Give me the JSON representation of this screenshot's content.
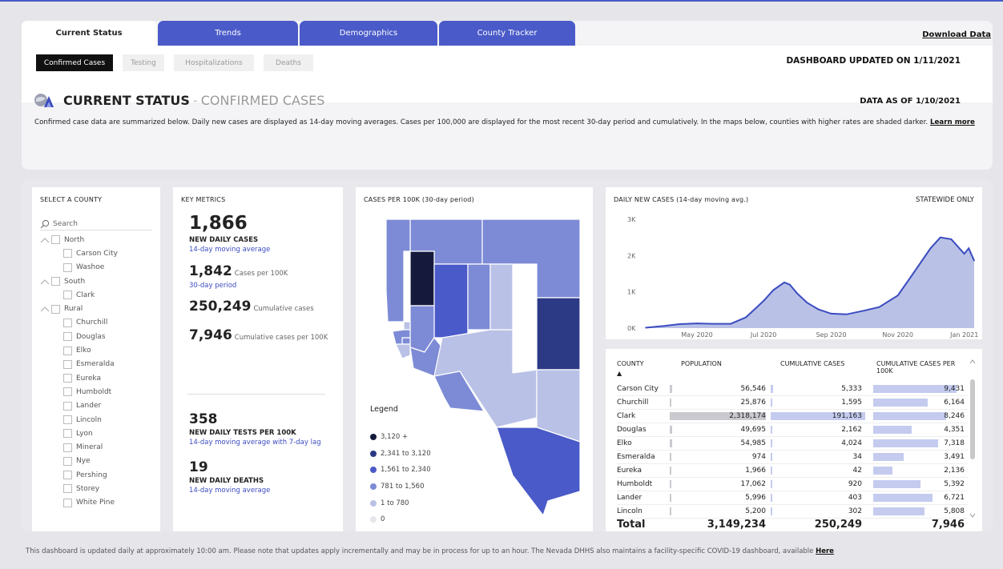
{
  "tabs": [
    {
      "label": "Current Status",
      "active": true
    },
    {
      "label": "Trends",
      "active": false
    },
    {
      "label": "Demographics",
      "active": false
    },
    {
      "label": "County Tracker",
      "active": false
    }
  ],
  "download_label": "Download Data",
  "subtabs": [
    {
      "label": "Confirmed Cases",
      "active": true
    },
    {
      "label": "Testing",
      "active": false
    },
    {
      "label": "Hospitalizations",
      "active": false
    },
    {
      "label": "Deaths",
      "active": false
    }
  ],
  "updated_text": "DASHBOARD UPDATED ON 1/11/2021",
  "title": {
    "main": "CURRENT STATUS",
    "separator": "-",
    "sub": "CONFIRMED CASES"
  },
  "data_as_of": "DATA AS OF 1/10/2021",
  "description": "Confirmed case data are summarized below. Daily new cases are displayed as 14-day moving averages. Cases per 100,000 are displayed for the most recent 30-day period and cumulatively. In the maps below, counties with higher rates are shaded darker.",
  "learn_more": "Learn more",
  "county_panel": {
    "title": "SELECT A COUNTY",
    "search_placeholder": "Search",
    "groups": [
      {
        "label": "North",
        "counties": [
          "Carson City",
          "Washoe"
        ]
      },
      {
        "label": "South",
        "counties": [
          "Clark"
        ]
      },
      {
        "label": "Rural",
        "counties": [
          "Churchill",
          "Douglas",
          "Elko",
          "Esmeralda",
          "Eureka",
          "Humboldt",
          "Lander",
          "Lincoln",
          "Lyon",
          "Mineral",
          "Nye",
          "Pershing",
          "Storey",
          "White Pine"
        ]
      }
    ]
  },
  "metrics": {
    "title": "KEY METRICS",
    "new_daily_cases": "1,866",
    "new_daily_cases_label": "NEW DAILY CASES",
    "new_daily_cases_sub": "14-day moving average",
    "cases_per_100k": "1,842",
    "cases_per_100k_label": "Cases per 100K",
    "cases_per_100k_sub": "30-day period",
    "cumulative_cases": "250,249",
    "cumulative_cases_label": "Cumulative cases",
    "cumulative_per_100k": "7,946",
    "cumulative_per_100k_label": "Cumulative cases per 100K",
    "tests": "358",
    "tests_label": "NEW DAILY TESTS PER 100K",
    "tests_sub": "14-day moving average with 7-day lag",
    "deaths": "19",
    "deaths_label": "NEW DAILY DEATHS",
    "deaths_sub": "14-day moving average"
  },
  "map": {
    "title": "CASES PER 100K (30-day period)",
    "legend_title": "Legend",
    "legend": [
      {
        "label": "3,120 +",
        "color": "#151a3d"
      },
      {
        "label": "2,341 to 3,120",
        "color": "#2c3a86"
      },
      {
        "label": "1,561 to 2,340",
        "color": "#4a5ac8"
      },
      {
        "label": "781 to 1,560",
        "color": "#7d8bd6"
      },
      {
        "label": "1 to 780",
        "color": "#b9c1e6"
      },
      {
        "label": "0",
        "color": "#e6e6ea"
      }
    ]
  },
  "line_chart": {
    "title": "DAILY NEW CASES (14-day moving avg.)",
    "statewide": "STATEWIDE ONLY"
  },
  "chart_data": {
    "type": "area",
    "yticks": [
      "3K",
      "2K",
      "1K",
      "0K"
    ],
    "xticks": [
      "May 2020",
      "Jul 2020",
      "Sep 2020",
      "Nov 2020",
      "Jan 2021"
    ],
    "ylim": [
      0,
      3000
    ],
    "x": [
      "2020-03-15",
      "2020-04-01",
      "2020-04-15",
      "2020-05-01",
      "2020-05-15",
      "2020-06-01",
      "2020-06-15",
      "2020-07-01",
      "2020-07-10",
      "2020-07-20",
      "2020-07-25",
      "2020-08-01",
      "2020-08-10",
      "2020-08-20",
      "2020-09-01",
      "2020-09-15",
      "2020-10-01",
      "2020-10-15",
      "2020-11-01",
      "2020-11-15",
      "2020-12-01",
      "2020-12-10",
      "2020-12-20",
      "2021-01-01",
      "2021-01-05",
      "2021-01-10"
    ],
    "values": [
      10,
      60,
      110,
      130,
      120,
      120,
      300,
      750,
      1050,
      1260,
      1200,
      950,
      700,
      520,
      400,
      380,
      480,
      580,
      900,
      1500,
      2200,
      2500,
      2450,
      2050,
      2200,
      1860
    ],
    "grid": false
  },
  "table": {
    "headers": [
      "COUNTY",
      "POPULATION",
      "CUMULATIVE CASES",
      "CUMULATIVE CASES PER 100K"
    ],
    "sort_indicator": "▲",
    "rows": [
      {
        "county": "Carson City",
        "population": "56,546",
        "cases": "5,333",
        "per100k": "9,431"
      },
      {
        "county": "Churchill",
        "population": "25,876",
        "cases": "1,595",
        "per100k": "6,164"
      },
      {
        "county": "Clark",
        "population": "2,318,174",
        "cases": "191,163",
        "per100k": "8,246"
      },
      {
        "county": "Douglas",
        "population": "49,695",
        "cases": "2,162",
        "per100k": "4,351"
      },
      {
        "county": "Elko",
        "population": "54,985",
        "cases": "4,024",
        "per100k": "7,318"
      },
      {
        "county": "Esmeralda",
        "population": "974",
        "cases": "34",
        "per100k": "3,491"
      },
      {
        "county": "Eureka",
        "population": "1,966",
        "cases": "42",
        "per100k": "2,136"
      },
      {
        "county": "Humboldt",
        "population": "17,062",
        "cases": "920",
        "per100k": "5,392"
      },
      {
        "county": "Lander",
        "population": "5,996",
        "cases": "403",
        "per100k": "6,721"
      },
      {
        "county": "Lincoln",
        "population": "5,200",
        "cases": "302",
        "per100k": "5,808"
      }
    ],
    "total": {
      "label": "Total",
      "population": "3,149,234",
      "cases": "250,249",
      "per100k": "7,946"
    }
  },
  "footer": {
    "text": "This dashboard is updated daily at approximately 10:00 am. Please note that updates apply incrementally and may be in process for up to an hour.  The Nevada DHHS also maintains a facility-specific COVID-19 dashboard, available",
    "link": "Here"
  }
}
